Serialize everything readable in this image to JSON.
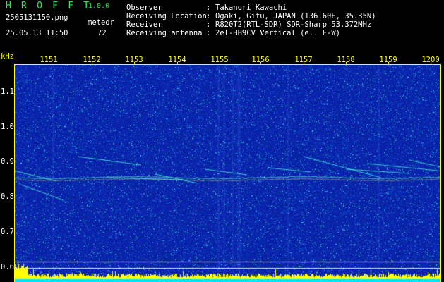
{
  "header": {
    "brand": "H R O F F T",
    "version": "1.0.0",
    "filename": "2505131150.png",
    "timestamp": "25.05.13 11:50",
    "meteor_label": "meteor",
    "meteor_count": "72"
  },
  "station_info": [
    {
      "label": "Observer",
      "value": "Takanori Kawachi"
    },
    {
      "label": "Receiving Location",
      "value": "Ogaki, Gifu, JAPAN (136.60E, 35.35N)"
    },
    {
      "label": "Receiver",
      "value": "R820T2(RTL-SDR) SDR-Sharp 53.372MHz"
    },
    {
      "label": "Receiving antenna",
      "value": "2el-HB9CV Vertical (el. E-W)"
    }
  ],
  "axis": {
    "unit": "kHz",
    "time_ticks": [
      "1151",
      "1152",
      "1153",
      "1154",
      "1155",
      "1156",
      "1157",
      "1158",
      "1159",
      "1200"
    ],
    "freq_ticks": [
      "1.1",
      "1.0",
      "0.9",
      "0.8",
      "0.7",
      "0.6"
    ]
  },
  "colors": {
    "background": "#000000",
    "spectrogram_base": "#0a1aa8",
    "text_green": "#2ee84f",
    "text_yellow": "#ffff00",
    "text_white": "#ffffff"
  }
}
